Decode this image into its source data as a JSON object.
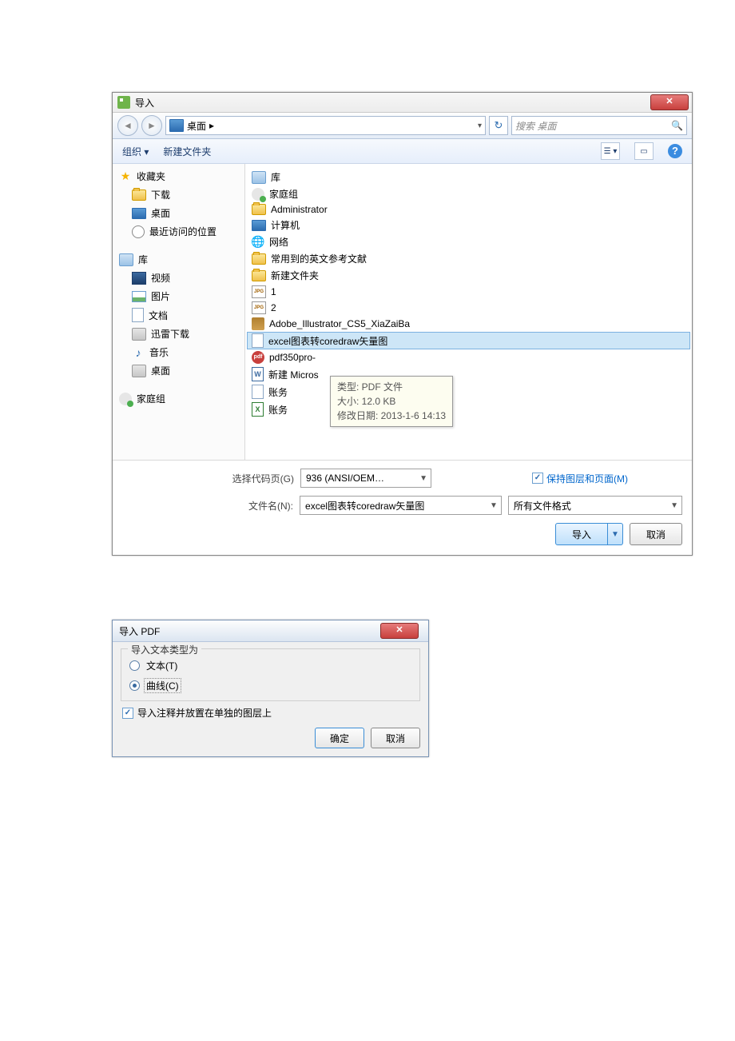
{
  "dlg1": {
    "title": "导入",
    "breadcrumb": {
      "location": "桌面",
      "arrow": "▸",
      "dropdown": "▾"
    },
    "refresh_glyph": "↻",
    "search": {
      "placeholder": "搜索 桌面",
      "icon": "🔍"
    },
    "toolbar": {
      "organize": "组织 ▾",
      "newfolder": "新建文件夹",
      "views_glyph": "☰ ▾",
      "pane_glyph": "▭",
      "help": "?"
    },
    "sidebar": {
      "favorites": {
        "label": "收藏夹",
        "items": [
          "下载",
          "桌面",
          "最近访问的位置"
        ]
      },
      "libraries": {
        "label": "库",
        "items": [
          "视频",
          "图片",
          "文档",
          "迅雷下载",
          "音乐",
          "桌面"
        ]
      },
      "homegroup": {
        "label": "家庭组"
      }
    },
    "files": [
      {
        "icon": "libs",
        "label": "库"
      },
      {
        "icon": "fg",
        "label": "家庭组"
      },
      {
        "icon": "user",
        "label": "Administrator"
      },
      {
        "icon": "pc",
        "label": "计算机"
      },
      {
        "icon": "net",
        "label": "网络"
      },
      {
        "icon": "folder",
        "label": "常用到的英文参考文献"
      },
      {
        "icon": "folder",
        "label": "新建文件夹"
      },
      {
        "icon": "jpg",
        "label": "1"
      },
      {
        "icon": "jpg",
        "label": "2"
      },
      {
        "icon": "cd",
        "label": "Adobe_Illustrator_CS5_XiaZaiBa"
      },
      {
        "icon": "pdf",
        "label": "excel图表转coredraw矢量图",
        "selected": true
      },
      {
        "icon": "pdf",
        "label": "pdf350pro-"
      },
      {
        "icon": "word",
        "label": "新建 Micros"
      },
      {
        "icon": "pdf2",
        "label": "账务"
      },
      {
        "icon": "xls",
        "label": "账务"
      }
    ],
    "tooltip": {
      "line1": "类型: PDF 文件",
      "line2": "大小: 12.0 KB",
      "line3": "修改日期: 2013-1-6 14:13"
    },
    "codepage": {
      "label": "选择代码页(G)",
      "value": "936   (ANSI/OEM…"
    },
    "keeplayers": {
      "label": "保持图层和页面(M)"
    },
    "filename": {
      "label": "文件名(N):",
      "value": "excel图表转coredraw矢量图"
    },
    "filter": {
      "value": "所有文件格式"
    },
    "buttons": {
      "import": "导入",
      "cancel": "取消"
    }
  },
  "dlg2": {
    "title": "导入 PDF",
    "group_label": "导入文本类型为",
    "radio_text": "文本(T)",
    "radio_curve": "曲线(C)",
    "checkbox": "导入注释并放置在单独的图层上",
    "ok": "确定",
    "cancel": "取消"
  }
}
